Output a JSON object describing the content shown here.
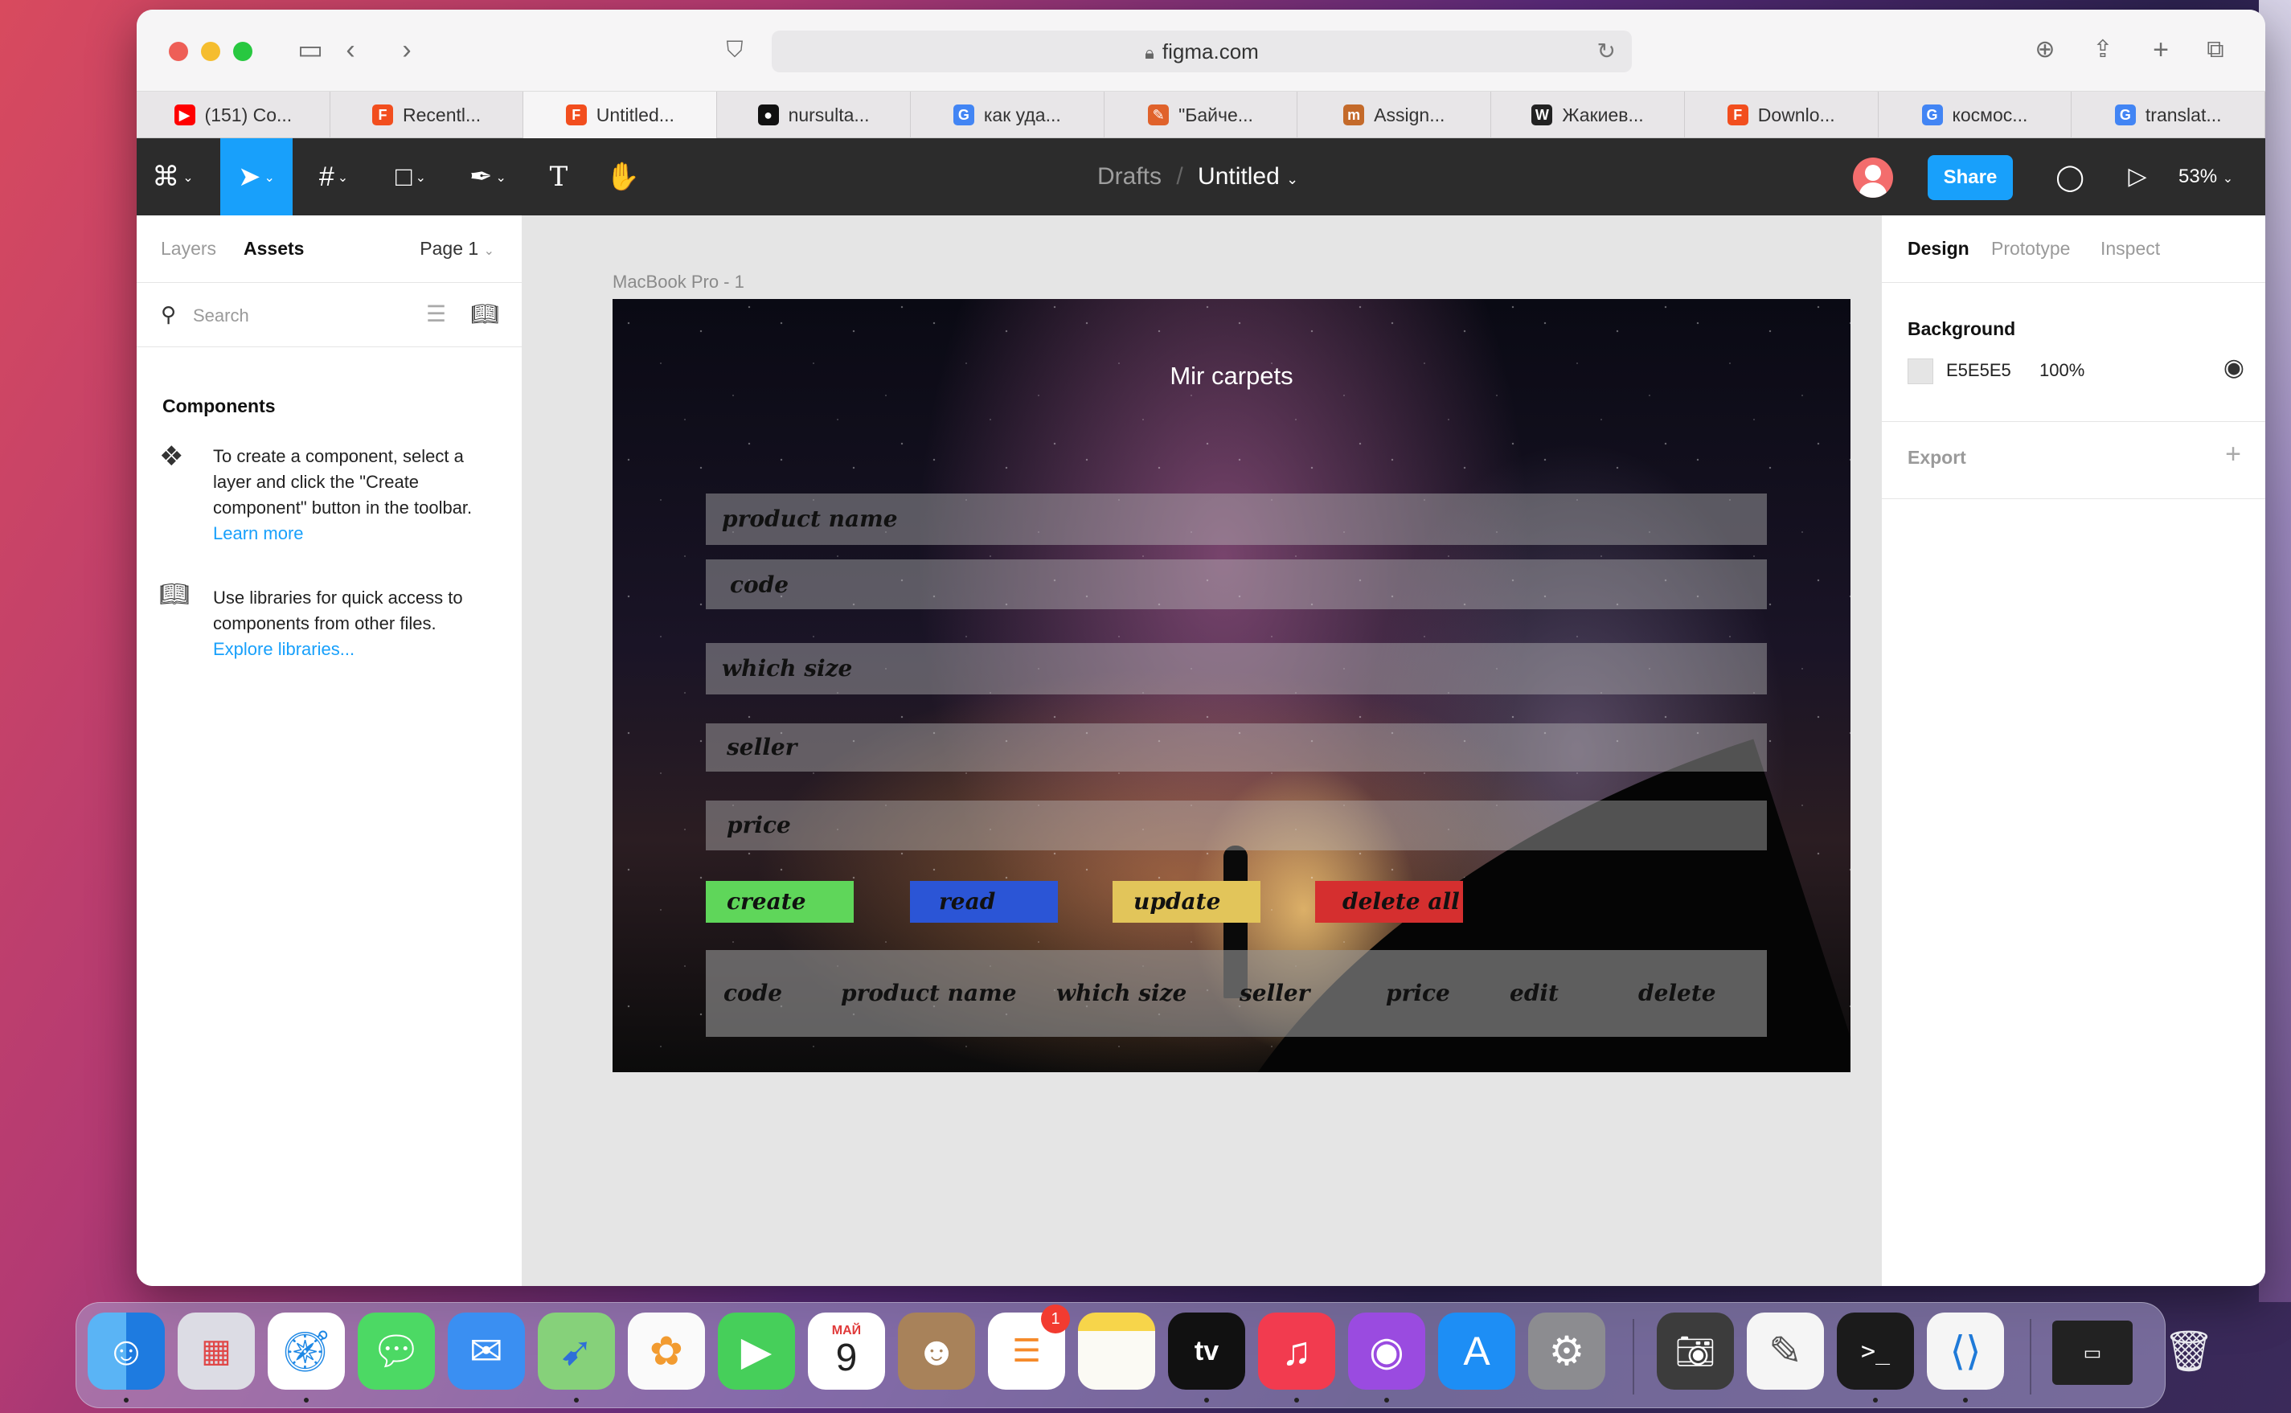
{
  "browser": {
    "address": "figma.com",
    "tabs": [
      {
        "label": "(151) Co...",
        "icon": "youtube-icon",
        "color": "#ff0000",
        "glyph": "▶"
      },
      {
        "label": "Recentl...",
        "icon": "figma-icon",
        "color": "#f24e1e",
        "glyph": "F"
      },
      {
        "label": "Untitled...",
        "icon": "figma-icon",
        "color": "#f24e1e",
        "glyph": "F"
      },
      {
        "label": "nursulta...",
        "icon": "github-icon",
        "color": "#111111",
        "glyph": "●"
      },
      {
        "label": "как уда...",
        "icon": "google-icon",
        "color": "#4285f4",
        "glyph": "G"
      },
      {
        "label": "\"Байче...",
        "icon": "site-icon",
        "color": "#e0622b",
        "glyph": "✎"
      },
      {
        "label": "Assign...",
        "icon": "site-icon",
        "color": "#c46a2a",
        "glyph": "m"
      },
      {
        "label": "Жакиев...",
        "icon": "wikipedia-icon",
        "color": "#222222",
        "glyph": "W"
      },
      {
        "label": "Downlo...",
        "icon": "figma-icon",
        "color": "#f24e1e",
        "glyph": "F"
      },
      {
        "label": "космос...",
        "icon": "google-icon",
        "color": "#4285f4",
        "glyph": "G"
      },
      {
        "label": "translat...",
        "icon": "google-icon",
        "color": "#4285f4",
        "glyph": "G"
      }
    ],
    "active_tab": 2
  },
  "figma": {
    "breadcrumb_parent": "Drafts",
    "separator": "/",
    "file_name": "Untitled",
    "share_label": "Share",
    "zoom": "53%"
  },
  "left_panel": {
    "tab_layers": "Layers",
    "tab_assets": "Assets",
    "page": "Page 1",
    "search_placeholder": "Search",
    "components_heading": "Components",
    "component_text": "To create a component, select a layer and click the \"Create component\" button in the toolbar.",
    "component_link": "Learn more",
    "library_text": "Use libraries for quick access to components from other files.",
    "library_link": "Explore libraries..."
  },
  "canvas": {
    "frame_label": "MacBook Pro - 1",
    "app_title": "Mir carpets",
    "fields": [
      "product name",
      "code",
      "which size",
      "seller",
      "price"
    ],
    "buttons": [
      {
        "label": "create",
        "color": "#5fd65a"
      },
      {
        "label": "read",
        "color": "#2b55d6"
      },
      {
        "label": "update",
        "color": "#e2c55a"
      },
      {
        "label": "delete all",
        "color": "#d52f2f"
      }
    ],
    "columns": [
      "code",
      "product name",
      "which size",
      "seller",
      "price",
      "edit",
      "delete"
    ]
  },
  "right_panel": {
    "tab_design": "Design",
    "tab_prototype": "Prototype",
    "tab_inspect": "Inspect",
    "background_heading": "Background",
    "background_hex": "E5E5E5",
    "background_opacity": "100%",
    "export_label": "Export"
  },
  "dock": {
    "calendar_month": "МАЙ",
    "calendar_day": "9",
    "reminders_badge": "1",
    "apps": [
      "finder",
      "launchpad",
      "safari",
      "messages",
      "mail",
      "maps",
      "photos",
      "facetime",
      "calendar",
      "contacts",
      "reminders",
      "notes",
      "tv",
      "music",
      "podcasts",
      "app-store",
      "system-preferences",
      "image-capture",
      "textedit",
      "terminal",
      "vscode",
      "window-preview",
      "trash"
    ]
  }
}
